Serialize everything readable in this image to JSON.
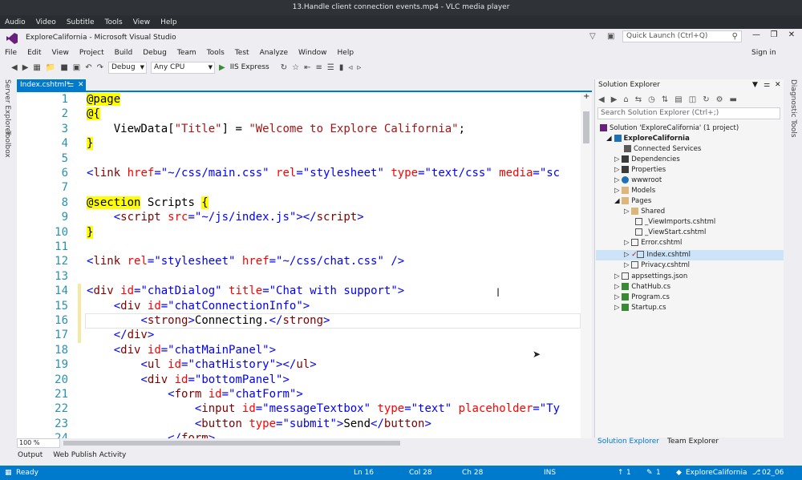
{
  "vlc": {
    "title": "13.Handle client connection events.mp4 - VLC media player",
    "menu": [
      "Audio",
      "Video",
      "Subtitle",
      "Tools",
      "View",
      "Help"
    ]
  },
  "vs": {
    "title": "ExploreCalifornia - Microsoft Visual Studio",
    "quick_launch": "Quick Launch (Ctrl+Q)",
    "menu": [
      "File",
      "Edit",
      "View",
      "Project",
      "Build",
      "Debug",
      "Team",
      "Tools",
      "Test",
      "Analyze",
      "Window",
      "Help"
    ],
    "sign_in": "Sign in",
    "toolbar": {
      "config": "Debug",
      "platform": "Any CPU",
      "run": "IIS Express"
    },
    "left_strip": [
      "Server Explorer",
      "Toolbox"
    ],
    "right_strip": [
      "Diagnostic Tools"
    ]
  },
  "editor": {
    "tab": "Index.cshtml*",
    "zoom": "100 %",
    "line_numbers": [
      "1",
      "2",
      "3",
      "4",
      "5",
      "6",
      "7",
      "8",
      "9",
      "10",
      "11",
      "12",
      "13",
      "14",
      "15",
      "16",
      "17",
      "18",
      "19",
      "20",
      "21",
      "22",
      "23",
      "24"
    ]
  },
  "solution_explorer": {
    "title": "Solution Explorer",
    "search": "Search Solution Explorer (Ctrl+;)",
    "items": [
      "Solution 'ExploreCalifornia' (1 project)",
      "ExploreCalifornia",
      "Connected Services",
      "Dependencies",
      "Properties",
      "wwwroot",
      "Models",
      "Pages",
      "Shared",
      "_ViewImports.cshtml",
      "_ViewStart.cshtml",
      "Error.cshtml",
      "Index.cshtml",
      "Privacy.cshtml",
      "appsettings.json",
      "ChatHub.cs",
      "Program.cs",
      "Startup.cs"
    ],
    "tabs": [
      "Solution Explorer",
      "Team Explorer"
    ]
  },
  "output_tabs": [
    "Output",
    "Web Publish Activity"
  ],
  "status": {
    "ready": "Ready",
    "ln": "Ln 16",
    "col": "Col 28",
    "ch": "Ch 28",
    "ins": "INS",
    "up": "1",
    "pencil": "1",
    "project": "ExploreCalifornia",
    "branch": "02_06"
  },
  "colors": {
    "accent": "#007acc",
    "tag": "#800000",
    "attr": "#ff0000",
    "string": "#0000ff",
    "linenum": "#2b91af"
  }
}
